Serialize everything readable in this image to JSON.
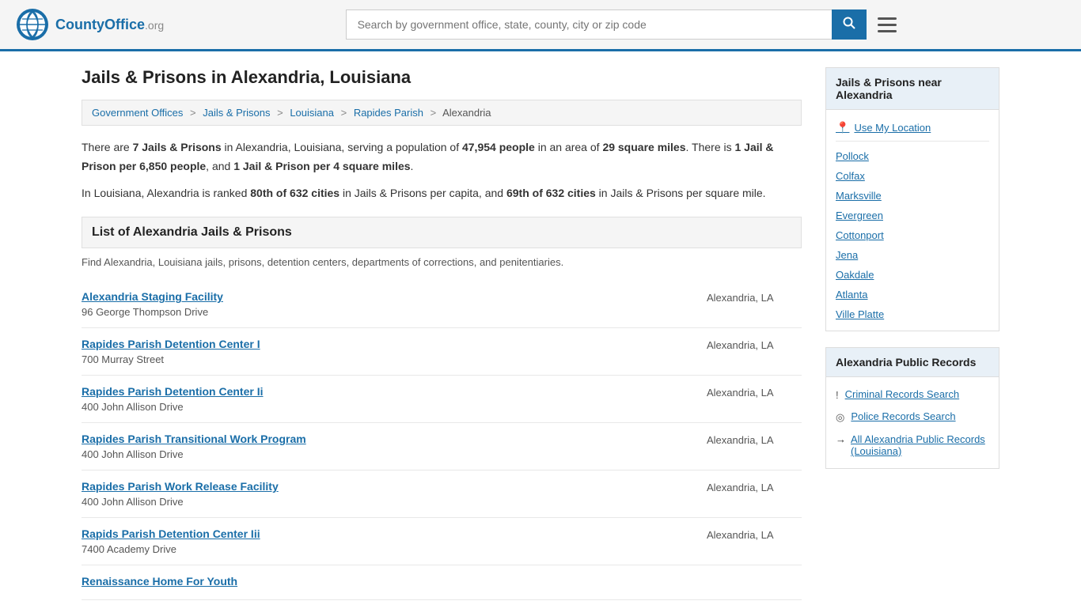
{
  "header": {
    "logo_text": "CountyOffice",
    "logo_suffix": ".org",
    "search_placeholder": "Search by government office, state, county, city or zip code",
    "search_value": ""
  },
  "page": {
    "title": "Jails & Prisons in Alexandria, Louisiana",
    "breadcrumb": [
      {
        "label": "Government Offices",
        "href": "#"
      },
      {
        "label": "Jails & Prisons",
        "href": "#"
      },
      {
        "label": "Louisiana",
        "href": "#"
      },
      {
        "label": "Rapides Parish",
        "href": "#"
      },
      {
        "label": "Alexandria",
        "href": "#"
      }
    ],
    "stats": {
      "line1_pre": "There are ",
      "count": "7 Jails & Prisons",
      "line1_mid": " in Alexandria, Louisiana, serving a population of ",
      "population": "47,954 people",
      "line1_post": " in an area of ",
      "area": "29 square miles",
      "line1_end": ". There is ",
      "per_capita": "1 Jail & Prison per 6,850 people",
      "line1_comma": ", and ",
      "per_sqmile": "1 Jail & Prison per 4 square miles",
      "line1_final": ".",
      "line2_pre": "In Louisiana, Alexandria is ranked ",
      "rank1": "80th of 632 cities",
      "line2_mid": " in Jails & Prisons per capita, and ",
      "rank2": "69th of 632 cities",
      "line2_end": " in Jails & Prisons per square mile."
    },
    "list_heading": "List of Alexandria Jails & Prisons",
    "list_desc": "Find Alexandria, Louisiana jails, prisons, detention centers, departments of corrections, and penitentiaries.",
    "facilities": [
      {
        "name": "Alexandria Staging Facility",
        "address": "96 George Thompson Drive",
        "city": "Alexandria, LA"
      },
      {
        "name": "Rapides Parish Detention Center I",
        "address": "700 Murray Street",
        "city": "Alexandria, LA"
      },
      {
        "name": "Rapides Parish Detention Center Ii",
        "address": "400 John Allison Drive",
        "city": "Alexandria, LA"
      },
      {
        "name": "Rapides Parish Transitional Work Program",
        "address": "400 John Allison Drive",
        "city": "Alexandria, LA"
      },
      {
        "name": "Rapides Parish Work Release Facility",
        "address": "400 John Allison Drive",
        "city": "Alexandria, LA"
      },
      {
        "name": "Rapids Parish Detention Center Iii",
        "address": "7400 Academy Drive",
        "city": "Alexandria, LA"
      },
      {
        "name": "Renaissance Home For Youth",
        "address": "",
        "city": ""
      }
    ]
  },
  "sidebar": {
    "nearby_title": "Jails & Prisons near Alexandria",
    "use_my_location": "Use My Location",
    "nearby_cities": [
      "Pollock",
      "Colfax",
      "Marksville",
      "Evergreen",
      "Cottonport",
      "Jena",
      "Oakdale",
      "Atlanta",
      "Ville Platte"
    ],
    "public_records_title": "Alexandria Public Records",
    "public_records": [
      {
        "icon": "!",
        "label": "Criminal Records Search"
      },
      {
        "icon": "◎",
        "label": "Police Records Search"
      }
    ],
    "all_records_label": "All Alexandria Public Records (Louisiana)"
  }
}
